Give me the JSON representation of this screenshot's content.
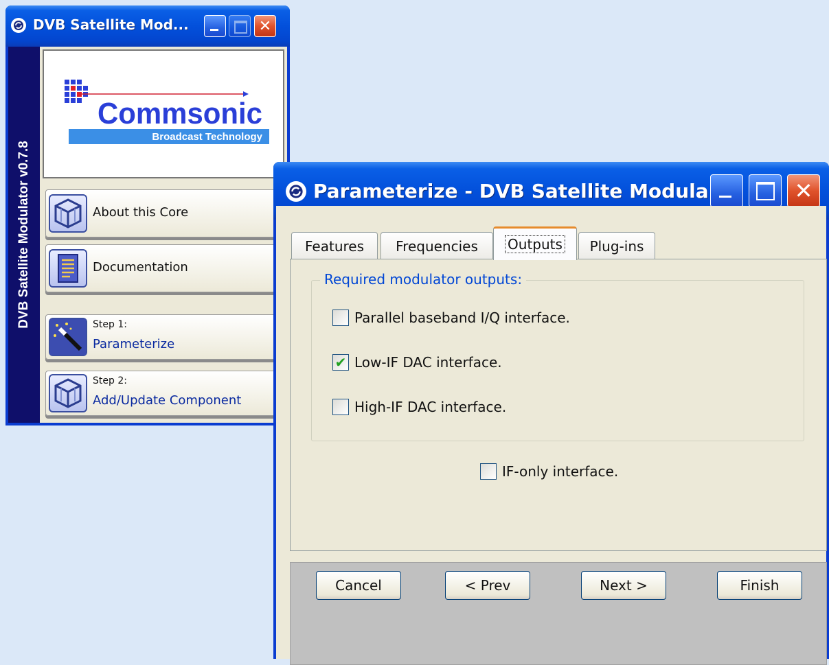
{
  "core_window": {
    "title": "DVB Satellite Mod...",
    "vertical_title": "DVB Satellite Modulator v0.7.8",
    "logo": {
      "brand": "Commsonic",
      "tagline": "Broadcast Technology"
    },
    "buttons": {
      "about": "About this Core",
      "documentation": "Documentation",
      "step1_label": "Step 1:",
      "step1_action": "Parameterize",
      "step2_label": "Step 2:",
      "step2_action": "Add/Update Component"
    }
  },
  "param_window": {
    "title": "Parameterize - DVB Satellite Modula...",
    "tabs": [
      "Features",
      "Frequencies",
      "Outputs",
      "Plug-ins"
    ],
    "active_tab": "Outputs",
    "group_title": "Required modulator outputs:",
    "options": [
      {
        "label": "Parallel baseband I/Q interface.",
        "checked": false
      },
      {
        "label": "Low-IF DAC interface.",
        "checked": true
      },
      {
        "label": "High-IF DAC interface.",
        "checked": false
      }
    ],
    "if_only": {
      "label": "IF-only interface.",
      "checked": false
    },
    "buttons": {
      "cancel": "Cancel",
      "prev": "< Prev",
      "next": "Next >",
      "finish": "Finish"
    }
  },
  "colors": {
    "desktop": "#dbe8f8",
    "titlebar": "#0350db",
    "dialog_face": "#ece9d8",
    "group_title": "#0046d5",
    "check_mark": "#21a121",
    "message_area": "#c0c0c0"
  }
}
